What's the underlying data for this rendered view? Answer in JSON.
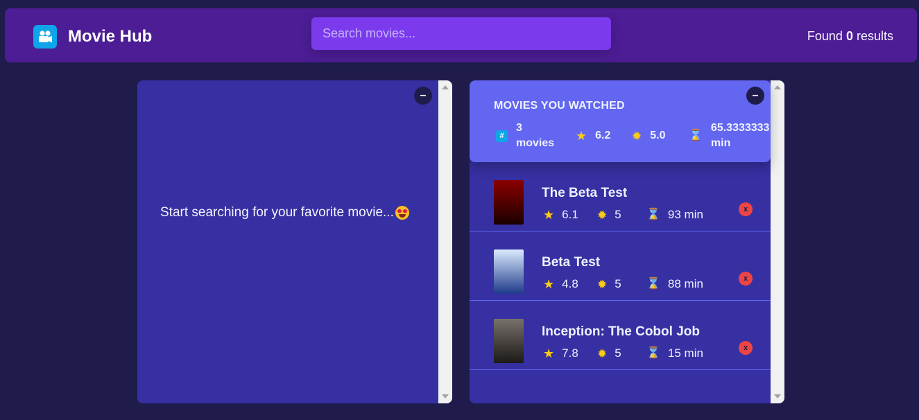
{
  "app": {
    "title": "Movie Hub",
    "accent_color": "#7c3aed",
    "navbar_color": "#4c1d95",
    "background_color": "#1f1c4c",
    "logo_icon": "video-camera-icon"
  },
  "search": {
    "placeholder": "Search movies...",
    "value": ""
  },
  "results": {
    "prefix": "Found",
    "count": "0",
    "suffix": "results"
  },
  "search_box": {
    "toggle_label": "–",
    "empty_message": "Start searching for your favorite movie...",
    "empty_emoji_icon": "heart-eyes-emoji-icon"
  },
  "watched_box": {
    "toggle_label": "–",
    "summary": {
      "title": "MOVIES YOU WATCHED",
      "movies_count": "3",
      "movies_unit": "movies",
      "avg_imdb_rating": "6.2",
      "avg_user_rating": "5.0",
      "avg_runtime": "65.3333333",
      "runtime_unit": "min"
    },
    "movies": [
      {
        "title": "The Beta Test",
        "imdb_rating": "6.1",
        "user_rating": "5",
        "runtime": "93 min",
        "remove_label": "x",
        "poster_colors": [
          "#8b0000",
          "#1a0000"
        ]
      },
      {
        "title": "Beta Test",
        "imdb_rating": "4.8",
        "user_rating": "5",
        "runtime": "88 min",
        "remove_label": "x",
        "poster_colors": [
          "#dbeafe",
          "#1e3a8a"
        ]
      },
      {
        "title": "Inception: The Cobol Job",
        "imdb_rating": "7.8",
        "user_rating": "5",
        "runtime": "15 min",
        "remove_label": "x",
        "poster_colors": [
          "#78716c",
          "#1c1917"
        ]
      }
    ]
  },
  "icons": {
    "count": "hash-icon",
    "imdb": "star-icon",
    "user": "sun-icon",
    "runtime": "hourglass-icon"
  }
}
